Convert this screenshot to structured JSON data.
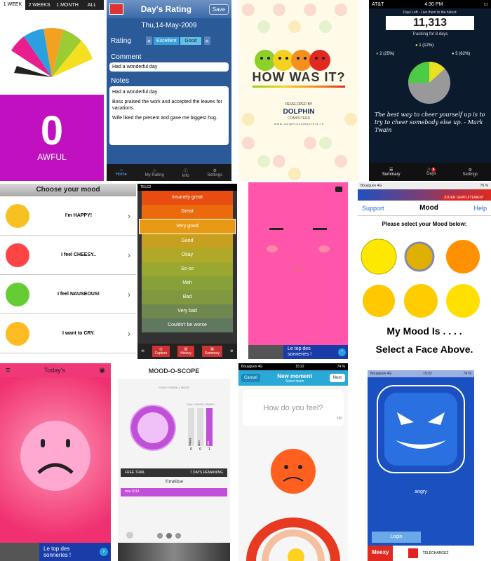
{
  "p1": {
    "tabs": [
      "1 WEEK",
      "2 WEEKS",
      "1 MONTH",
      "ALL"
    ],
    "score": "0",
    "label": "AWFUL",
    "colors": {
      "bg": "#c010c0"
    }
  },
  "p2": {
    "title": "Day's Rating",
    "save": "Save",
    "date": "Thu,14-May-2009",
    "rating_label": "Rating",
    "rating_opts": [
      "Excellent",
      "Good"
    ],
    "comment_label": "Comment",
    "comment_value": "Had  a wonderful day",
    "notes_label": "Notes",
    "notes": [
      "Had  a wonderful day",
      "Boss praised the work and accepted the leaves for vacations.",
      "Wife liked the present and gave me biggest hug."
    ],
    "nav": [
      "Home",
      "My Rating",
      "Info",
      "Settings"
    ]
  },
  "p3": {
    "title": "HOW WAS IT?",
    "dev": "DEVELOPED BY",
    "brand": "DOLPHIN",
    "brand_sub": "COMPUTERS",
    "url": "w w w . d o l p h i n c o m p u t e r s . i n"
  },
  "p4": {
    "carrier": "AT&T",
    "time": "4:30 PM",
    "days_left": "Days Left - Live them to the fullest:",
    "count": "11,313",
    "tracking": "Tracking for 8 days",
    "stat_good": "2 (25%)",
    "stat_mid": "1 (12%)",
    "stat_bad": "5 (62%)",
    "quote": "The best way to cheer yourself up is to try to cheer somebody else up. - Mark Twain",
    "nav": [
      "Summary",
      "Days",
      "Settings"
    ],
    "badge": "8"
  },
  "p5": {
    "title": "Choose your mood",
    "items": [
      "I'm HAPPY!",
      "I feel CHEESY..",
      "I feel NAUSEOUS!",
      "I want to CRY."
    ]
  },
  "p6": {
    "carrier": "TELE2",
    "items": [
      "Insanely great",
      "Great",
      "Very good",
      "Good",
      "Okay",
      "So-so",
      "Meh",
      "Bad",
      "Very bad",
      "Couldn't be worse"
    ],
    "nav": [
      "Capture",
      "History",
      "Summary"
    ]
  },
  "p7": {
    "ad_text1": "Le top des",
    "ad_text2": "sonneries !"
  },
  "p8": {
    "carrier": "Bouygues",
    "net": "4G",
    "battery": "76 %",
    "ad": "JOUER GRATUITEMENT",
    "support": "Support",
    "title": "Mood",
    "help": "Help",
    "instruction": "Please select your Mood below:",
    "mood_is": "My Mood Is . . . .",
    "select": "Select a Face Above."
  },
  "p9": {
    "title": "Today's",
    "ad_text1": "Le top des",
    "ad_text2": "sonneries !"
  },
  "p10": {
    "title": "MOOD-O-SCOPE",
    "overall": "YOUR OVERALL MOOD",
    "graph": "DAILY MOOD GRAPH",
    "bars": [
      "Happy",
      "Meh",
      "Sad"
    ],
    "counts": [
      "0",
      "0",
      "1"
    ],
    "trial": "FREE TRAIL",
    "remaining": "7 DAYS REMAINING",
    "timeline": "Timeline",
    "month": "mai 2014"
  },
  "p11": {
    "carrier": "Bouygues",
    "net": "4G",
    "time": "15:22",
    "battery": "74 %",
    "cancel": "Cancel",
    "title": "New moment",
    "subtitle": "Select team",
    "next": "Next",
    "question": "How do you feel?",
    "chars": "140"
  },
  "p12": {
    "carrier": "Bouygues",
    "net": "4G",
    "time": "15:22",
    "battery": "74 %",
    "mood": "angry",
    "login": "Login",
    "brand": "Meexy",
    "download": "TÉLÉCHARGEZ"
  }
}
